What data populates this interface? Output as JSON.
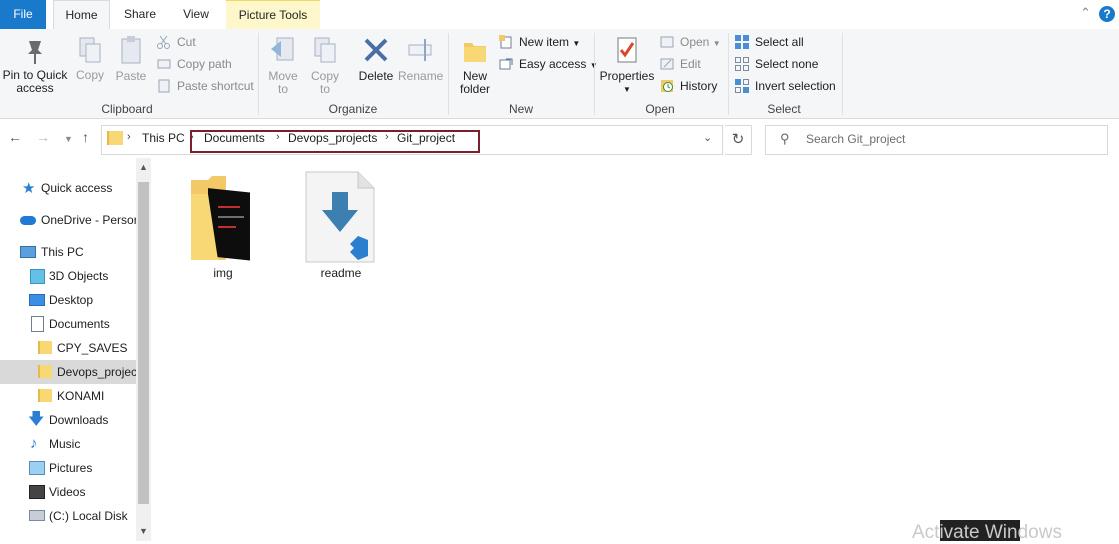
{
  "tabs": {
    "file": "File",
    "home": "Home",
    "share": "Share",
    "view": "View",
    "picture_tools": "Picture Tools"
  },
  "ribbon": {
    "clipboard": {
      "pin": "Pin to Quick access",
      "copy": "Copy",
      "paste": "Paste",
      "cut": "Cut",
      "copy_path": "Copy path",
      "paste_shortcut": "Paste shortcut",
      "label": "Clipboard"
    },
    "organize": {
      "move_to": "Move to",
      "copy_to": "Copy to",
      "delete": "Delete",
      "rename": "Rename",
      "label": "Organize"
    },
    "new": {
      "new_folder": "New folder",
      "new_item": "New item",
      "easy_access": "Easy access",
      "label": "New"
    },
    "open": {
      "properties": "Properties",
      "open": "Open",
      "edit": "Edit",
      "history": "History",
      "label": "Open"
    },
    "select": {
      "select_all": "Select all",
      "select_none": "Select none",
      "invert": "Invert selection",
      "label": "Select"
    }
  },
  "address": {
    "crumbs": [
      "This PC",
      "Documents",
      "Devops_projects",
      "Git_project"
    ],
    "search_placeholder": "Search Git_project"
  },
  "sidebar": {
    "items": [
      {
        "label": "Quick access",
        "icon": "star-icon"
      },
      {
        "label": "OneDrive - Persor",
        "icon": "cloud-icon"
      },
      {
        "label": "This PC",
        "icon": "computer-icon"
      },
      {
        "label": "3D Objects",
        "icon": "cube-icon"
      },
      {
        "label": "Desktop",
        "icon": "desktop-icon"
      },
      {
        "label": "Documents",
        "icon": "document-icon"
      },
      {
        "label": "CPY_SAVES",
        "icon": "folder-icon"
      },
      {
        "label": "Devops_projec",
        "icon": "folder-icon"
      },
      {
        "label": "KONAMI",
        "icon": "folder-icon"
      },
      {
        "label": "Downloads",
        "icon": "download-icon"
      },
      {
        "label": "Music",
        "icon": "music-icon"
      },
      {
        "label": "Pictures",
        "icon": "picture-icon"
      },
      {
        "label": "Videos",
        "icon": "video-icon"
      },
      {
        "label": "(C:) Local Disk",
        "icon": "disk-icon"
      }
    ]
  },
  "files": [
    {
      "name": "img",
      "type": "folder"
    },
    {
      "name": "readme",
      "type": "file"
    }
  ],
  "watermark": "Activate Windows",
  "colors": {
    "accent": "#1979ca",
    "highlight": "#7a1f2b",
    "selected": "#d9d9d9"
  }
}
